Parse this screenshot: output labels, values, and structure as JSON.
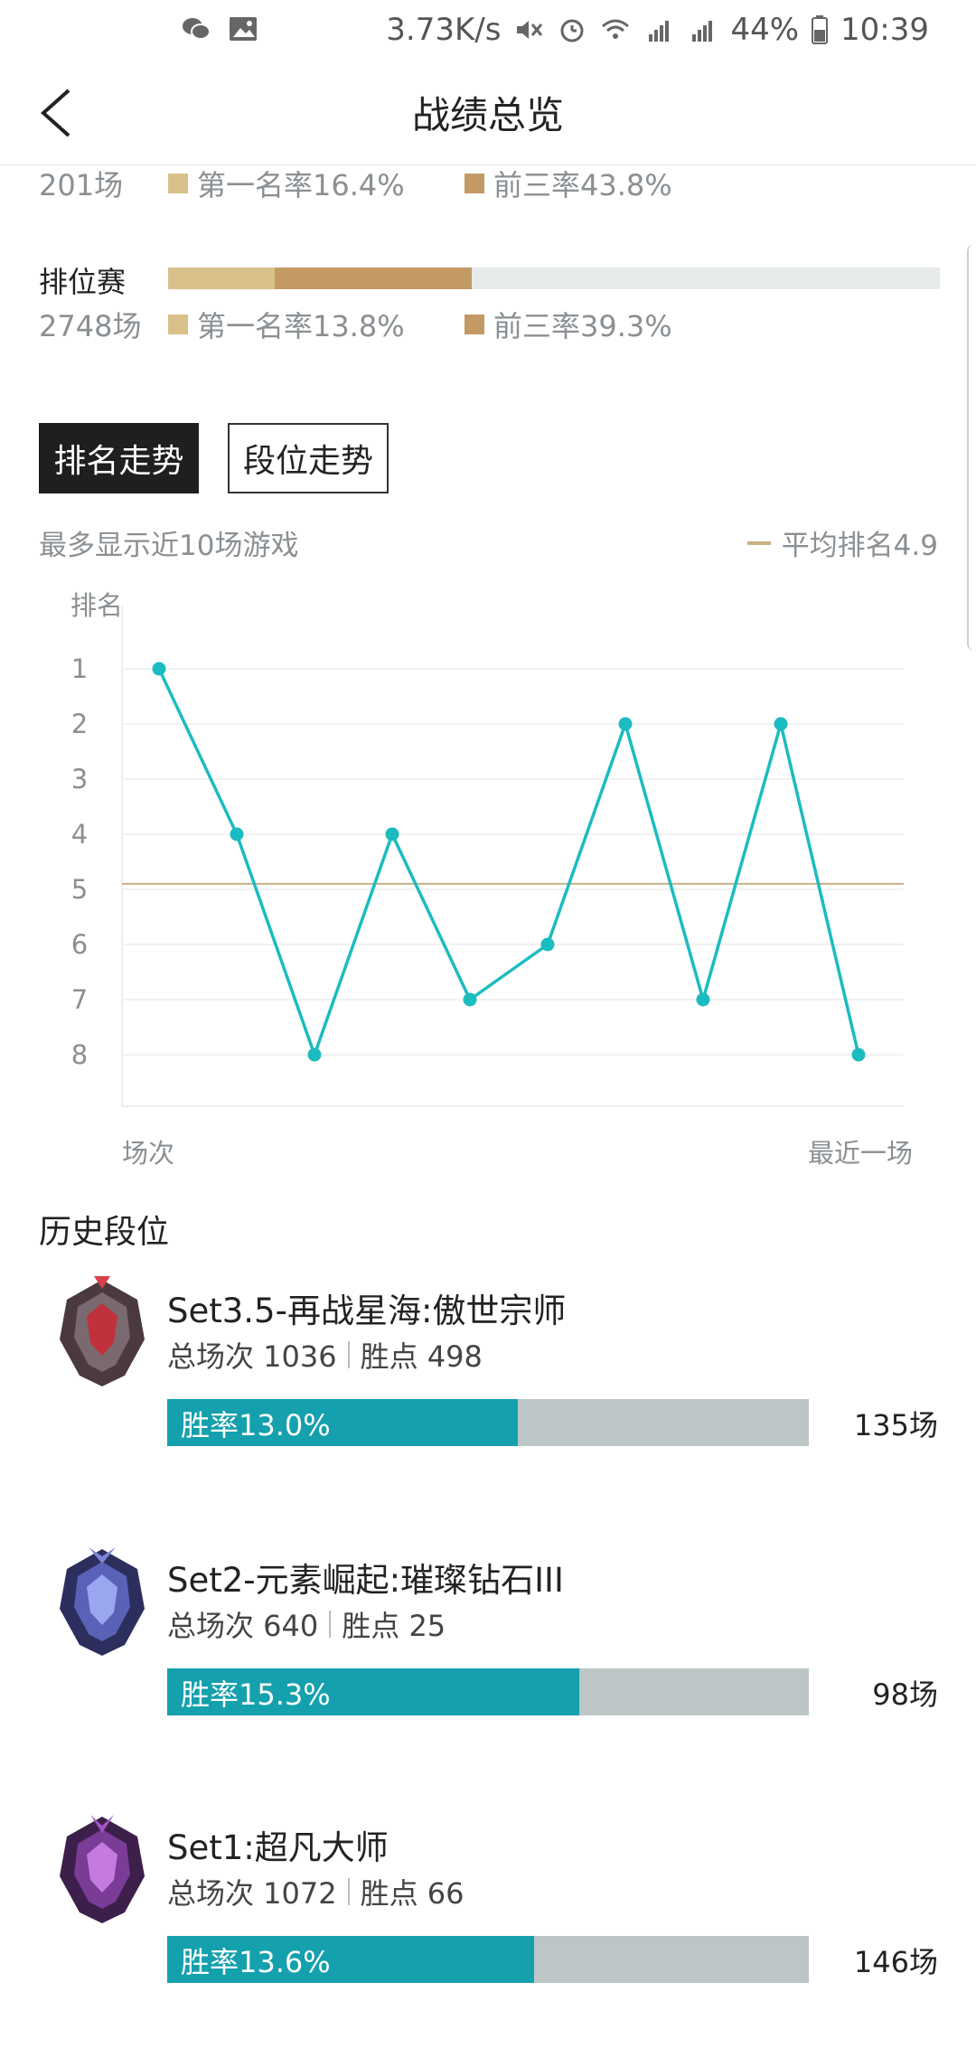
{
  "status_bar": {
    "speed": "3.73K/s",
    "battery": "44%",
    "time": "10:39"
  },
  "header": {
    "title": "战绩总览"
  },
  "normal_stats": {
    "count": "201场",
    "first_rate": "第一名率16.4%",
    "top3_rate": "前三率43.8%"
  },
  "ranked_stats": {
    "label": "排位赛",
    "count": "2748场",
    "first_rate": "第一名率13.8%",
    "top3_rate": "前三率39.3%",
    "first_fraction": 0.138,
    "top3_fraction": 0.393
  },
  "tabs": {
    "rank_trend": "排名走势",
    "tier_trend": "段位走势"
  },
  "chart_note": "最多显示近10场游戏",
  "avg_legend": "平均排名4.9",
  "chart_data": {
    "type": "line",
    "ylabel": "排名",
    "xlabel_start": "场次",
    "xlabel_end": "最近一场",
    "y_ticks": [
      1,
      2,
      3,
      4,
      5,
      6,
      7,
      8
    ],
    "ylim": [
      1,
      8
    ],
    "y_inverted": true,
    "average": 4.9,
    "series": [
      {
        "values": [
          1,
          4,
          8,
          4,
          7,
          6,
          2,
          7,
          2,
          8
        ]
      }
    ],
    "colors": {
      "line": "#1bbcbf",
      "average": "#c8b283",
      "grid": "#eeeeee"
    }
  },
  "history": {
    "title": "历史段位",
    "seasons": [
      {
        "name": "Set3.5-再战星海:傲世宗师",
        "total": "总场次 1036",
        "points": "胜点 498",
        "win_label": "胜率13.0%",
        "win_fraction": 0.13,
        "games": "135场",
        "emblem": "grandmaster-emblem"
      },
      {
        "name": "Set2-元素崛起:璀璨钻石III",
        "total": "总场次 640",
        "points": "胜点 25",
        "win_label": "胜率15.3%",
        "win_fraction": 0.153,
        "games": "98场",
        "emblem": "diamond-emblem"
      },
      {
        "name": "Set1:超凡大师",
        "total": "总场次 1072",
        "points": "胜点 66",
        "win_label": "胜率13.6%",
        "win_fraction": 0.136,
        "games": "146场",
        "emblem": "master-emblem"
      }
    ]
  }
}
